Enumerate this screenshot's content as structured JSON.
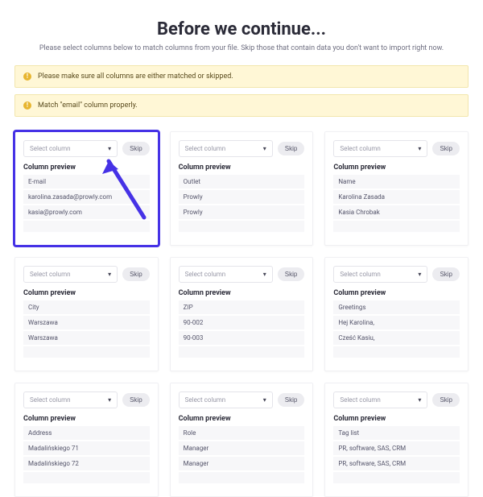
{
  "header": {
    "title": "Before we continue...",
    "subtitle": "Please select columns below to match columns from your file. Skip those that contain data you don't want to import right now."
  },
  "alerts": [
    {
      "icon": "!",
      "text": "Please make sure all columns are either matched or skipped."
    },
    {
      "icon": "!",
      "text": "Match \"email\" column properly."
    }
  ],
  "common": {
    "select_placeholder": "Select column",
    "skip_label": "Skip",
    "preview_label": "Column preview"
  },
  "cards": [
    {
      "highlighted": true,
      "rows": [
        "E-mail",
        "karolina.zasada@prowly.com",
        "kasia@prowly.com",
        ""
      ]
    },
    {
      "highlighted": false,
      "rows": [
        "Outlet",
        "Prowly",
        "Prowly",
        ""
      ]
    },
    {
      "highlighted": false,
      "rows": [
        "Name",
        "Karolina Zasada",
        "Kasia Chrobak",
        ""
      ]
    },
    {
      "highlighted": false,
      "rows": [
        "City",
        "Warszawa",
        "Warszawa",
        ""
      ]
    },
    {
      "highlighted": false,
      "rows": [
        "ZIP",
        "90-002",
        "90-003",
        ""
      ]
    },
    {
      "highlighted": false,
      "rows": [
        "Greetings",
        "Hej Karolina,",
        "Cześć Kasiu,",
        ""
      ]
    },
    {
      "highlighted": false,
      "rows": [
        "Address",
        "Madalińskiego 71",
        "Madalińskiego 72",
        ""
      ]
    },
    {
      "highlighted": false,
      "rows": [
        "Role",
        "Manager",
        "Manager",
        ""
      ]
    },
    {
      "highlighted": false,
      "rows": [
        "Tag list",
        "PR, software, SAS, CRM",
        "PR, software, SAS, CRM",
        ""
      ]
    }
  ],
  "colors": {
    "highlight": "#4632e6",
    "alert_bg": "#fff7d6"
  }
}
